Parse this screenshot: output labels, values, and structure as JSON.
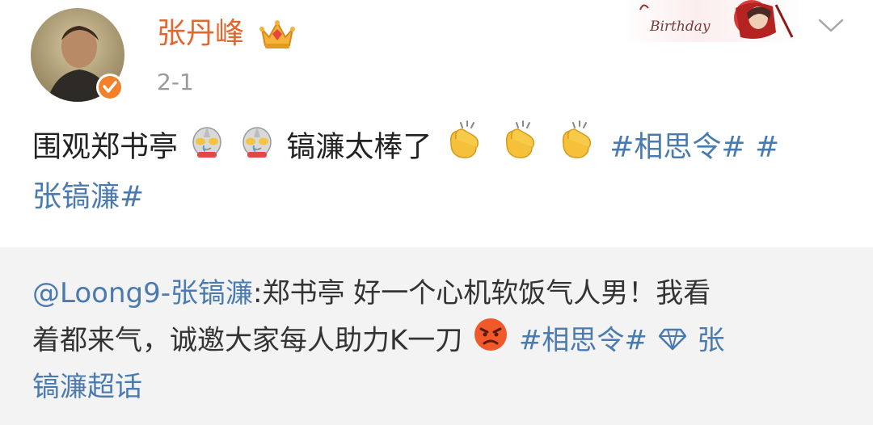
{
  "user": {
    "name": "张丹峰",
    "timestamp": "2-1",
    "avatar": "user-avatar",
    "verified_icon": "verified-badge-icon",
    "crown_icon": "crown-icon"
  },
  "header": {
    "banner_text": "Birthday",
    "menu_icon": "chevron-down-icon"
  },
  "post": {
    "line1_text": "围观郑书亭",
    "line1_text2": "镐濂太棒了",
    "tag1": "#相思令#",
    "tag2_part1": "#",
    "tag2_part2": "张镐濂#",
    "emoji_robot": "ultraman-emoji",
    "emoji_clap": "clap-emoji"
  },
  "repost": {
    "mention": "@Loong9-张镐濂",
    "text1": ":郑书亭 好一个心机软饭气人男！我看",
    "text2": "着都来气，诚邀大家每人助力K一刀",
    "tag1": "#相思令#",
    "supertopic_icon": "diamond-icon",
    "supertopic_label_part1": "张",
    "supertopic_label_part2": "镐濂超话",
    "emoji_angry": "angry-face-emoji"
  },
  "colors": {
    "username": "#e1672e",
    "link": "#4a7bb0",
    "text": "#222222",
    "muted": "#9a9a9a",
    "repost_bg": "#f3f3f3"
  }
}
